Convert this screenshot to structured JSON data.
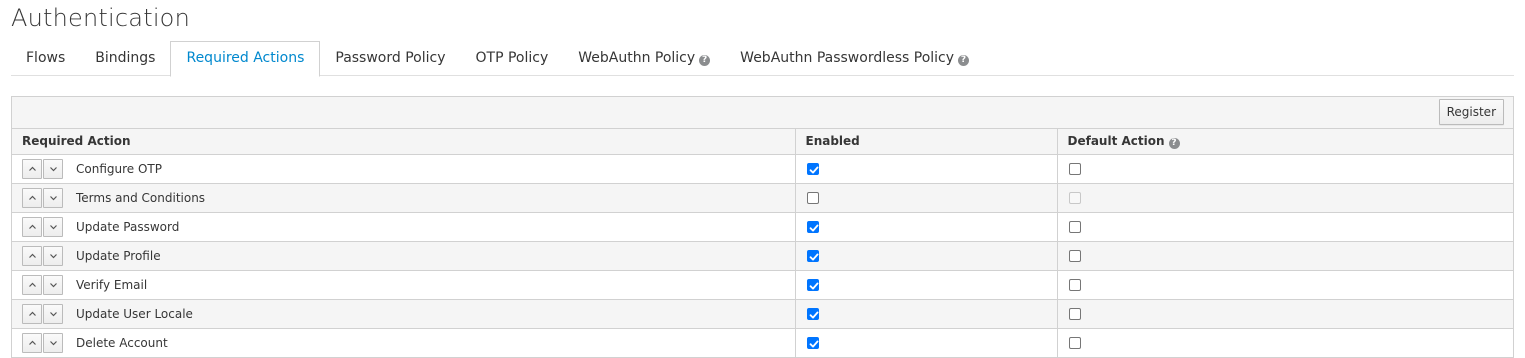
{
  "page": {
    "title": "Authentication"
  },
  "tabs": [
    {
      "label": "Flows",
      "active": false,
      "help": false
    },
    {
      "label": "Bindings",
      "active": false,
      "help": false
    },
    {
      "label": "Required Actions",
      "active": true,
      "help": false
    },
    {
      "label": "Password Policy",
      "active": false,
      "help": false
    },
    {
      "label": "OTP Policy",
      "active": false,
      "help": false
    },
    {
      "label": "WebAuthn Policy",
      "active": false,
      "help": true
    },
    {
      "label": "WebAuthn Passwordless Policy",
      "active": false,
      "help": true
    }
  ],
  "toolbar": {
    "register_label": "Register"
  },
  "table": {
    "columns": {
      "required_action": "Required Action",
      "enabled": "Enabled",
      "default_action": "Default Action"
    },
    "rows": [
      {
        "name": "Configure OTP",
        "enabled": true,
        "default": false,
        "default_disabled": false
      },
      {
        "name": "Terms and Conditions",
        "enabled": false,
        "default": false,
        "default_disabled": true
      },
      {
        "name": "Update Password",
        "enabled": true,
        "default": false,
        "default_disabled": false
      },
      {
        "name": "Update Profile",
        "enabled": true,
        "default": false,
        "default_disabled": false
      },
      {
        "name": "Verify Email",
        "enabled": true,
        "default": false,
        "default_disabled": false
      },
      {
        "name": "Update User Locale",
        "enabled": true,
        "default": false,
        "default_disabled": false
      },
      {
        "name": "Delete Account",
        "enabled": true,
        "default": false,
        "default_disabled": false
      }
    ]
  },
  "colors": {
    "accent": "#0088ce",
    "checkbox": "#0075ff",
    "stripe": "#f5f5f5",
    "border": "#d1d1d1"
  }
}
